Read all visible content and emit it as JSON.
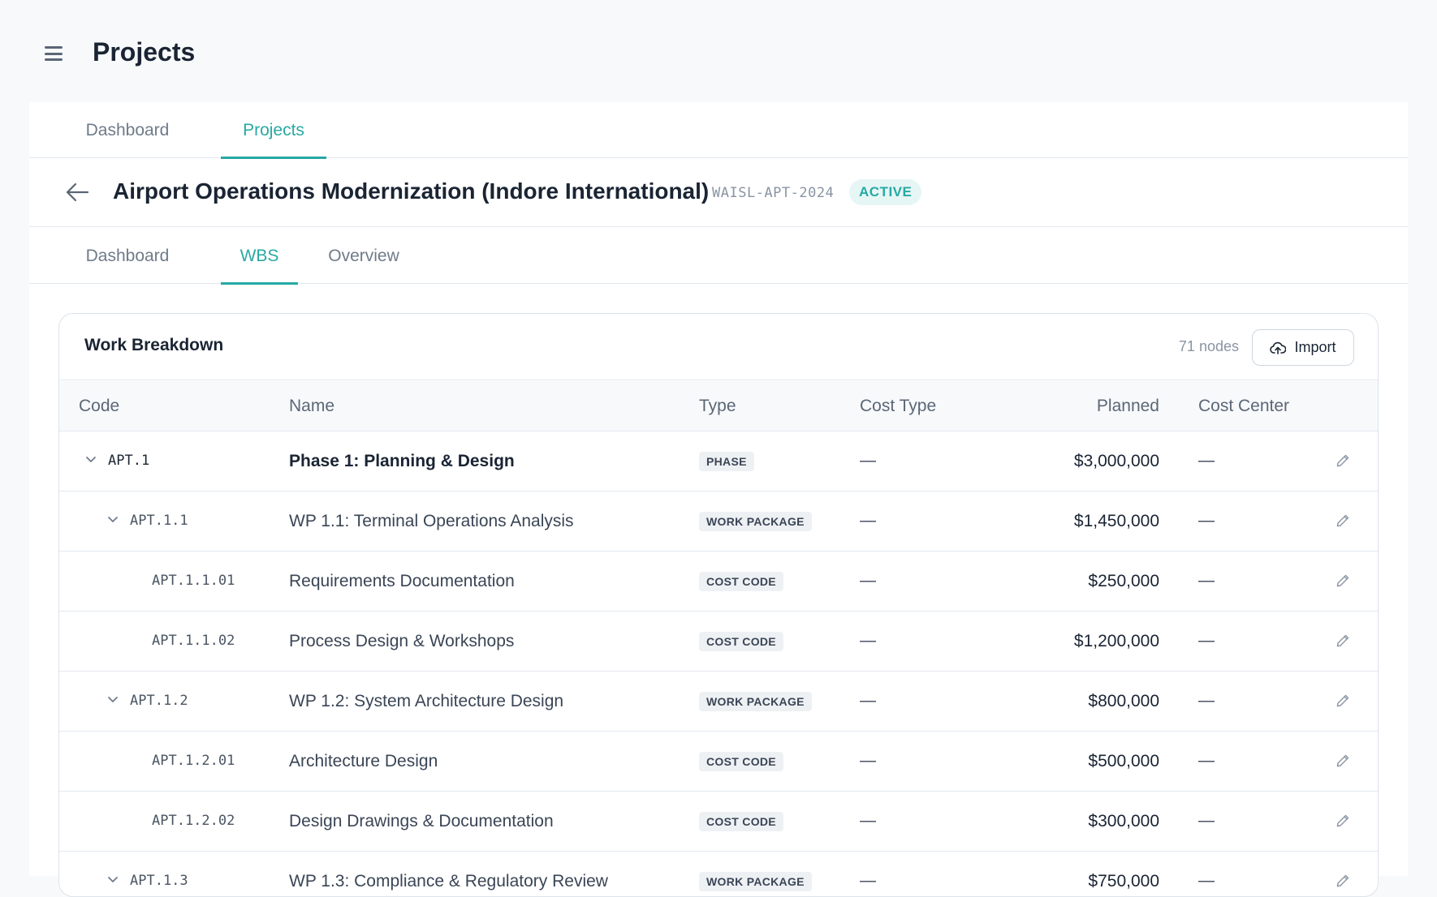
{
  "app": {
    "title": "Projects"
  },
  "top_tabs": [
    {
      "label": "Dashboard",
      "active": false
    },
    {
      "label": "Projects",
      "active": true
    }
  ],
  "project": {
    "title": "Airport Operations Modernization (Indore International)",
    "code": "WAISL-APT-2024",
    "status": "ACTIVE"
  },
  "project_tabs": [
    {
      "label": "Dashboard",
      "active": false
    },
    {
      "label": "WBS",
      "active": true
    },
    {
      "label": "Overview",
      "active": false
    }
  ],
  "wbs": {
    "title": "Work Breakdown",
    "node_count": "71 nodes",
    "import_label": "Import",
    "columns": {
      "code": "Code",
      "name": "Name",
      "type": "Type",
      "cost_type": "Cost Type",
      "planned": "Planned",
      "cost_center": "Cost Center"
    },
    "rows": [
      {
        "level": 0,
        "expandable": true,
        "code": "APT.1",
        "name": "Phase 1: Planning & Design",
        "type": "PHASE",
        "cost_type": "—",
        "planned": "$3,000,000",
        "cost_center": "—"
      },
      {
        "level": 1,
        "expandable": true,
        "code": "APT.1.1",
        "name": "WP 1.1: Terminal Operations Analysis",
        "type": "WORK PACKAGE",
        "cost_type": "—",
        "planned": "$1,450,000",
        "cost_center": "—"
      },
      {
        "level": 2,
        "expandable": false,
        "code": "APT.1.1.01",
        "name": "Requirements Documentation",
        "type": "COST CODE",
        "cost_type": "—",
        "planned": "$250,000",
        "cost_center": "—"
      },
      {
        "level": 2,
        "expandable": false,
        "code": "APT.1.1.02",
        "name": "Process Design & Workshops",
        "type": "COST CODE",
        "cost_type": "—",
        "planned": "$1,200,000",
        "cost_center": "—"
      },
      {
        "level": 1,
        "expandable": true,
        "code": "APT.1.2",
        "name": "WP 1.2: System Architecture Design",
        "type": "WORK PACKAGE",
        "cost_type": "—",
        "planned": "$800,000",
        "cost_center": "—"
      },
      {
        "level": 2,
        "expandable": false,
        "code": "APT.1.2.01",
        "name": "Architecture Design",
        "type": "COST CODE",
        "cost_type": "—",
        "planned": "$500,000",
        "cost_center": "—"
      },
      {
        "level": 2,
        "expandable": false,
        "code": "APT.1.2.02",
        "name": "Design Drawings & Documentation",
        "type": "COST CODE",
        "cost_type": "—",
        "planned": "$300,000",
        "cost_center": "—"
      },
      {
        "level": 1,
        "expandable": true,
        "code": "APT.1.3",
        "name": "WP 1.3: Compliance & Regulatory Review",
        "type": "WORK PACKAGE",
        "cost_type": "—",
        "planned": "$750,000",
        "cost_center": "—"
      }
    ]
  },
  "colors": {
    "accent": "#27a9a4",
    "text": "#1a2433",
    "muted": "#8a94a3",
    "border": "#e3e8ee"
  },
  "icons": [
    "menu-icon",
    "back-arrow-icon",
    "cloud-upload-icon",
    "chevron-down-icon",
    "pencil-icon"
  ]
}
